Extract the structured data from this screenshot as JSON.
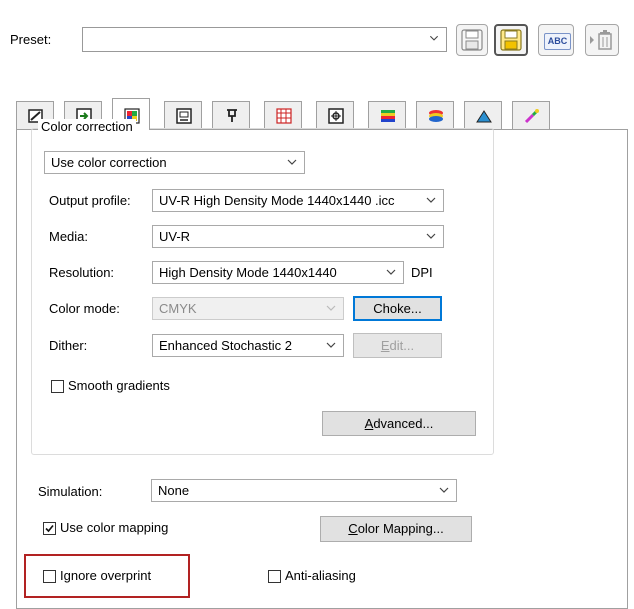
{
  "preset": {
    "label": "Preset:",
    "value": ""
  },
  "toolbar": {
    "icons": [
      "save-icon",
      "save-as-icon",
      "rename-icon",
      "delete-icon"
    ],
    "rename_text": "ABC"
  },
  "tabs": {
    "icons": [
      "layout-icon",
      "transform-icon",
      "color-icon",
      "printer-icon",
      "cut-icon",
      "tile-icon",
      "marks-icon",
      "swatch-icon",
      "layers-icon",
      "shape-icon",
      "eyedropper-icon"
    ],
    "active_index": 2
  },
  "color_correction": {
    "title": "Color correction",
    "mode": "Use color correction",
    "output_profile": {
      "label": "Output profile:",
      "value": "UV-R High Density Mode 1440x1440 .icc"
    },
    "media": {
      "label": "Media:",
      "value": "UV-R"
    },
    "resolution": {
      "label": "Resolution:",
      "value": "High Density Mode 1440x1440",
      "unit": "DPI"
    },
    "color_mode": {
      "label": "Color mode:",
      "value": "CMYK",
      "button": "Choke..."
    },
    "dither": {
      "label": "Dither:",
      "value": "Enhanced Stochastic 2",
      "button_prefix": "",
      "button_mnemonic": "E",
      "button_rest": "dit..."
    },
    "smooth_gradients": {
      "label": "Smooth gradients",
      "checked": false
    },
    "advanced": {
      "mnemonic": "A",
      "rest": "dvanced..."
    }
  },
  "simulation": {
    "label": "Simulation:",
    "value": "None"
  },
  "use_color_mapping": {
    "label": "Use color mapping",
    "checked": true
  },
  "color_mapping_button": {
    "mnemonic": "C",
    "rest": "olor Mapping..."
  },
  "ignore_overprint": {
    "label": "Ignore overprint",
    "checked": false
  },
  "anti_aliasing": {
    "label": "Anti-aliasing",
    "checked": false
  },
  "colors": {
    "highlight_border": "#b22222",
    "default_button_border": "#0078d7",
    "save_accent": "#f2c200"
  }
}
